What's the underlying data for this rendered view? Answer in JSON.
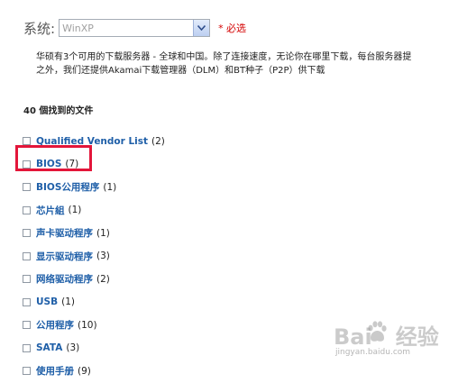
{
  "filter": {
    "os_label": "系统:",
    "os_value": "WinXP",
    "required_text": "* 必选"
  },
  "intro": {
    "line1": "华硕有3个可用的下载服务器 - 全球和中国。除了连接速度，无论你在哪里下载，每台服务器提",
    "line2": "之外，我们还提供Akamai下载管理器（DLM）和BT种子（P2P）供下载"
  },
  "results": {
    "title": "40 個找到的文件",
    "items": [
      {
        "name": "Qualified Vendor List",
        "count": "(2)"
      },
      {
        "name": "BIOS",
        "count": "(7)"
      },
      {
        "name": "BIOS公用程序",
        "count": "(1)"
      },
      {
        "name": "芯片組",
        "count": "(1)"
      },
      {
        "name": "声卡驱动程序",
        "count": "(1)"
      },
      {
        "name": "显示驱动程序",
        "count": "(3)"
      },
      {
        "name": "网络驱动程序",
        "count": "(2)"
      },
      {
        "name": "USB",
        "count": "(1)"
      },
      {
        "name": "公用程序",
        "count": "(10)"
      },
      {
        "name": "SATA",
        "count": "(3)"
      },
      {
        "name": "使用手册",
        "count": "(9)"
      }
    ]
  },
  "watermark": {
    "brand_left": "Bai",
    "brand_right": "经验",
    "url": "jingyan.baidu.com"
  },
  "colors": {
    "link": "#1f5fa8",
    "required": "#d40000",
    "highlight": "#e3163a"
  }
}
